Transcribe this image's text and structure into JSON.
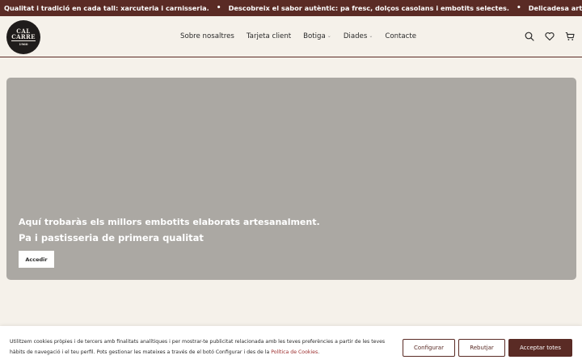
{
  "ticker": {
    "messages": [
      "Qualitat i tradició en cada tall: xarcuteria i carnisseria.",
      "Descobreix el sabor autèntic: pa fresc, dolços casolans i embotits selectes.",
      "Delicadesa artesanal en cada tast: pa, pastisse"
    ],
    "separator": "•"
  },
  "logo": {
    "line1": "CAL",
    "line2": "CARRE",
    "line3": "1960"
  },
  "nav": {
    "items": [
      {
        "label": "Sobre nosaltres",
        "dropdown": false
      },
      {
        "label": "Tarjeta client",
        "dropdown": false
      },
      {
        "label": "Botiga",
        "dropdown": true
      },
      {
        "label": "Diades",
        "dropdown": true
      },
      {
        "label": "Contacte",
        "dropdown": false
      }
    ]
  },
  "header_icons": [
    "search-icon",
    "heart-icon",
    "cart-icon"
  ],
  "hero": {
    "line1": "Aquí trobaràs els millors embotits elaborats artesanalment.",
    "line2": "Pa i pastisseria de primera qualitat",
    "button_label": "Accedir"
  },
  "cookie": {
    "text_prefix": " Utilitzem cookies pròpies i de tercers amb finalitats analítiques i per mostrar-te publicitat relacionada amb les teves preferències a partir de les teves hàbits de navegació i el teu perfil. Pots gestionar les mateixes a través de el botó Configurar i des de la ",
    "policy_link": "Política de Cookies",
    "text_suffix": ".",
    "configure_label": "Configurar",
    "reject_label": "Rebutjar",
    "accept_label": "Acceptar totes"
  },
  "colors": {
    "brand": "#5a2b25",
    "background": "#f5f1ea",
    "hero": "#aba8a3",
    "link": "#9b2c2c"
  }
}
